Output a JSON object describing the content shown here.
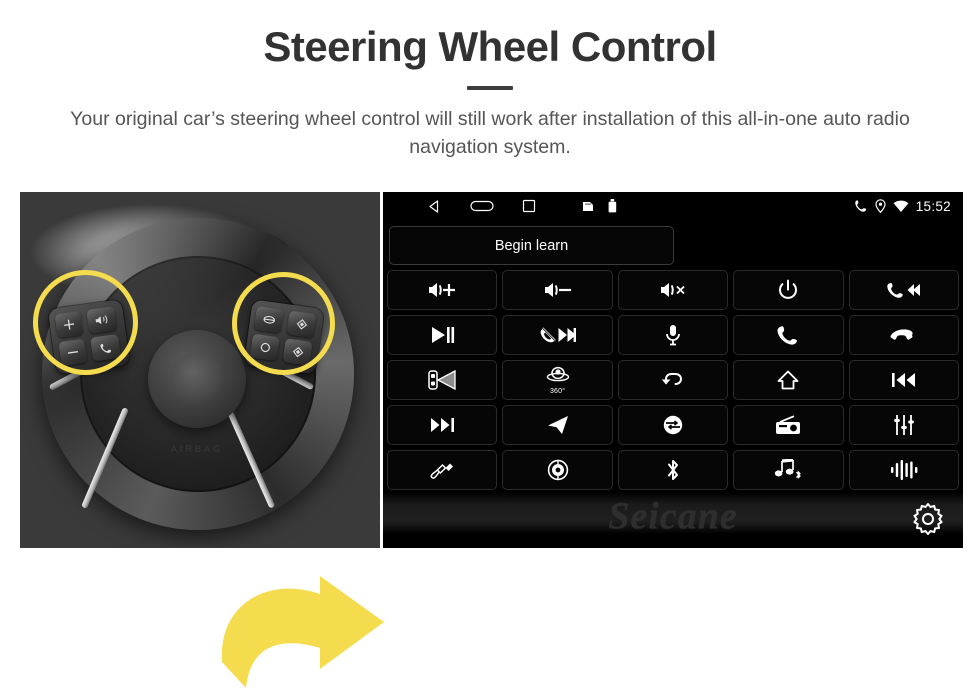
{
  "header": {
    "title": "Steering Wheel Control",
    "subtitle": "Your original car’s steering wheel control will still work after installation of this all-in-one auto radio navigation system."
  },
  "theme": {
    "highlight_yellow": "#F5DC4E",
    "title_color": "#323232",
    "subtitle_color": "#555555",
    "unit_background": "#000000",
    "button_border": "#2A2A2A"
  },
  "photo": {
    "alt": "steering-wheel-photo",
    "highlight_circle_left": "left-steering-wheel-control-pad",
    "highlight_circle_right": "right-steering-wheel-control-pad",
    "arrow": "yellow-arrow-pointing-right",
    "left_pad_keys": [
      "volume-up",
      "volume-down",
      "voice-command",
      "call"
    ],
    "right_pad_keys": [
      "mode",
      "up",
      "menu",
      "down"
    ],
    "airbag_text": "AIRBAG"
  },
  "unit": {
    "statusbar": {
      "nav_icons": [
        "back-icon",
        "home-icon",
        "recents-icon"
      ],
      "tray_icons": [
        "sd-card-icon",
        "usb-icon"
      ],
      "right_icons": [
        "phone-icon",
        "location-icon",
        "wifi-icon"
      ],
      "time": "15:52"
    },
    "begin_learn_label": "Begin learn",
    "label_360": "360°",
    "watermark": "Seicane",
    "settings_icon": "gear-icon",
    "buttons": [
      {
        "name": "volume-up-button",
        "icon": "speaker-plus"
      },
      {
        "name": "volume-down-button",
        "icon": "speaker-minus"
      },
      {
        "name": "mute-button",
        "icon": "speaker-x"
      },
      {
        "name": "power-button",
        "icon": "power"
      },
      {
        "name": "call-previous-button",
        "icon": "phone-prev"
      },
      {
        "name": "play-pause-button",
        "icon": "play-pause"
      },
      {
        "name": "reject-next-button",
        "icon": "phone-off-next"
      },
      {
        "name": "voice-command-button",
        "icon": "microphone"
      },
      {
        "name": "answer-call-button",
        "icon": "phone"
      },
      {
        "name": "hang-up-button",
        "icon": "phone-hangup"
      },
      {
        "name": "parking-sensor-button",
        "icon": "car-radar"
      },
      {
        "name": "camera-360-button",
        "icon": "camera-360"
      },
      {
        "name": "back-button",
        "icon": "back-arrow"
      },
      {
        "name": "home-button",
        "icon": "home"
      },
      {
        "name": "previous-track-button",
        "icon": "previous-track"
      },
      {
        "name": "next-track-button",
        "icon": "next-track"
      },
      {
        "name": "navigation-button",
        "icon": "nav-arrow"
      },
      {
        "name": "source-mode-button",
        "icon": "mode-circle"
      },
      {
        "name": "radio-button",
        "icon": "radio"
      },
      {
        "name": "equalizer-button",
        "icon": "equalizer"
      },
      {
        "name": "aux-input-button",
        "icon": "aux-plug"
      },
      {
        "name": "disc-button",
        "icon": "disc"
      },
      {
        "name": "bluetooth-button",
        "icon": "bluetooth"
      },
      {
        "name": "bluetooth-music-button",
        "icon": "bt-music"
      },
      {
        "name": "audio-waveform-button",
        "icon": "waveform"
      }
    ]
  }
}
